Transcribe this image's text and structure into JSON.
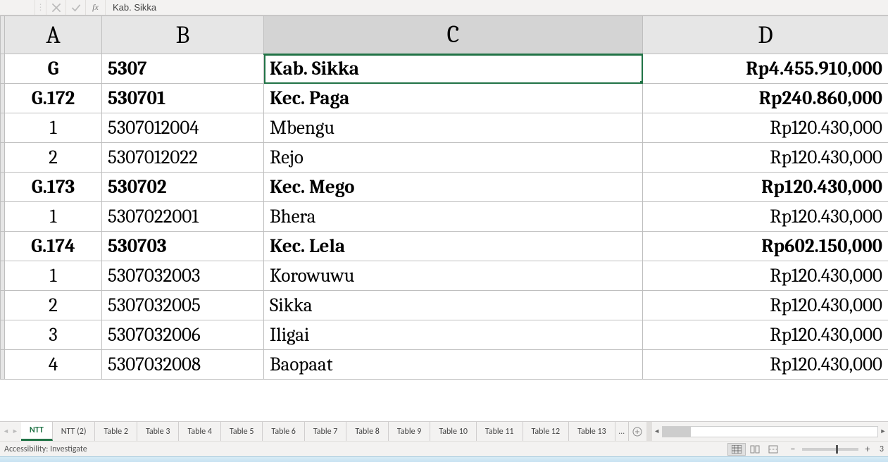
{
  "formula_bar": {
    "name_box": "",
    "value": "Kab. Sikka",
    "fx_label": "fx"
  },
  "columns": [
    "A",
    "B",
    "C",
    "D"
  ],
  "active_col_index": 2,
  "rows": [
    {
      "bold": true,
      "active_c": true,
      "A": "G",
      "B": "5307",
      "C": "Kab. Sikka",
      "D": "Rp4.455.910,000"
    },
    {
      "bold": true,
      "A": "G.172",
      "B": "530701",
      "C": "Kec. Paga",
      "D": "Rp240.860,000"
    },
    {
      "bold": false,
      "A": "1",
      "B": "5307012004",
      "C": "Mbengu",
      "D": "Rp120.430,000"
    },
    {
      "bold": false,
      "A": "2",
      "B": "5307012022",
      "C": "Rejo",
      "D": "Rp120.430,000"
    },
    {
      "bold": true,
      "A": "G.173",
      "B": "530702",
      "C": "Kec. Mego",
      "D": "Rp120.430,000"
    },
    {
      "bold": false,
      "A": "1",
      "B": "5307022001",
      "C": "Bhera",
      "D": "Rp120.430,000"
    },
    {
      "bold": true,
      "A": "G.174",
      "B": "530703",
      "C": "Kec. Lela",
      "D": "Rp602.150,000"
    },
    {
      "bold": false,
      "A": "1",
      "B": "5307032003",
      "C": "Korowuwu",
      "D": "Rp120.430,000"
    },
    {
      "bold": false,
      "A": "2",
      "B": "5307032005",
      "C": "Sikka",
      "D": "Rp120.430,000"
    },
    {
      "bold": false,
      "A": "3",
      "B": "5307032006",
      "C": "Iligai",
      "D": "Rp120.430,000"
    },
    {
      "bold": false,
      "A": "4",
      "B": "5307032008",
      "C": "Baopaat",
      "D": "Rp120.430,000"
    }
  ],
  "tabs": [
    {
      "label": "NTT",
      "active": true
    },
    {
      "label": "NTT (2)"
    },
    {
      "label": "Table 2"
    },
    {
      "label": "Table 3"
    },
    {
      "label": "Table 4"
    },
    {
      "label": "Table 5"
    },
    {
      "label": "Table 6"
    },
    {
      "label": "Table 7"
    },
    {
      "label": "Table 8"
    },
    {
      "label": "Table 9"
    },
    {
      "label": "Table 10"
    },
    {
      "label": "Table 11"
    },
    {
      "label": "Table 12"
    },
    {
      "label": "Table 13"
    }
  ],
  "tabs_more": "...",
  "status": {
    "text": "Accessibility: Investigate",
    "zoom_suffix": "3"
  },
  "icons": {
    "cancel": "×",
    "accept": "✓",
    "plus": "+",
    "minus": "−",
    "left": "◄",
    "right": "►"
  }
}
